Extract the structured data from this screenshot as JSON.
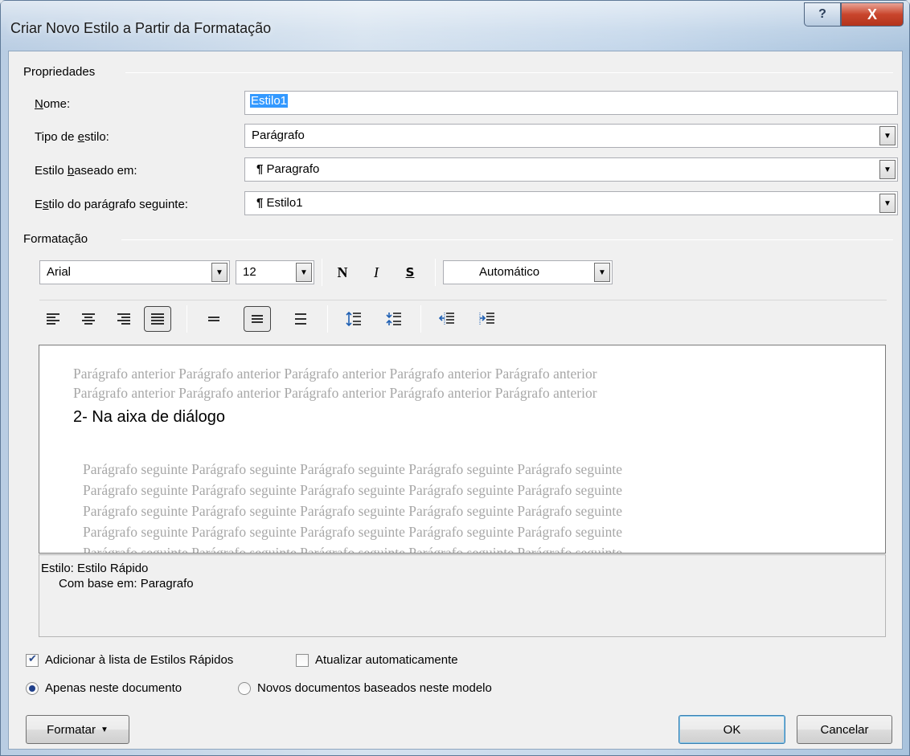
{
  "window": {
    "title": "Criar Novo Estilo a Partir da Formatação",
    "help_label": "?",
    "close_label": "X"
  },
  "properties": {
    "section_title": "Propriedades",
    "name_label": "Nome:",
    "name_value": "Estilo1",
    "type_label": "Tipo de estilo:",
    "type_value": "Parágrafo",
    "based_label": "Estilo baseado em:",
    "based_value": "Paragrafo",
    "next_label": "Estilo do parágrafo seguinte:",
    "next_value": "Estilo1",
    "paragraph_mark": "¶"
  },
  "formatting": {
    "section_title": "Formatação",
    "font": "Arial",
    "size": "12",
    "bold": "N",
    "italic": "I",
    "underline": "S",
    "color": "Automático"
  },
  "preview": {
    "previous_lines": [
      "Parágrafo anterior Parágrafo anterior Parágrafo anterior Parágrafo anterior Parágrafo anterior",
      "Parágrafo anterior Parágrafo anterior Parágrafo anterior Parágrafo anterior Parágrafo anterior"
    ],
    "current_text": "2- Na aixa de diálogo",
    "next_lines": [
      "Parágrafo seguinte Parágrafo seguinte Parágrafo seguinte Parágrafo seguinte Parágrafo seguinte",
      "Parágrafo seguinte Parágrafo seguinte Parágrafo seguinte Parágrafo seguinte Parágrafo seguinte",
      "Parágrafo seguinte Parágrafo seguinte Parágrafo seguinte Parágrafo seguinte Parágrafo seguinte",
      "Parágrafo seguinte Parágrafo seguinte Parágrafo seguinte Parágrafo seguinte Parágrafo seguinte",
      "Parágrafo seguinte Parágrafo seguinte Parágrafo seguinte Parágrafo seguinte Parágrafo seguinte"
    ]
  },
  "description": {
    "line1": "Estilo: Estilo Rápido",
    "line2": "Com base em: Paragrafo"
  },
  "options": {
    "add_quick_styles": "Adicionar à lista de Estilos Rápidos",
    "add_quick_styles_checked": true,
    "auto_update": "Atualizar automaticamente",
    "auto_update_checked": false,
    "only_document": "Apenas neste documento",
    "new_documents": "Novos documentos baseados neste modelo"
  },
  "buttons": {
    "format": "Formatar",
    "ok": "OK",
    "cancel": "Cancelar"
  }
}
